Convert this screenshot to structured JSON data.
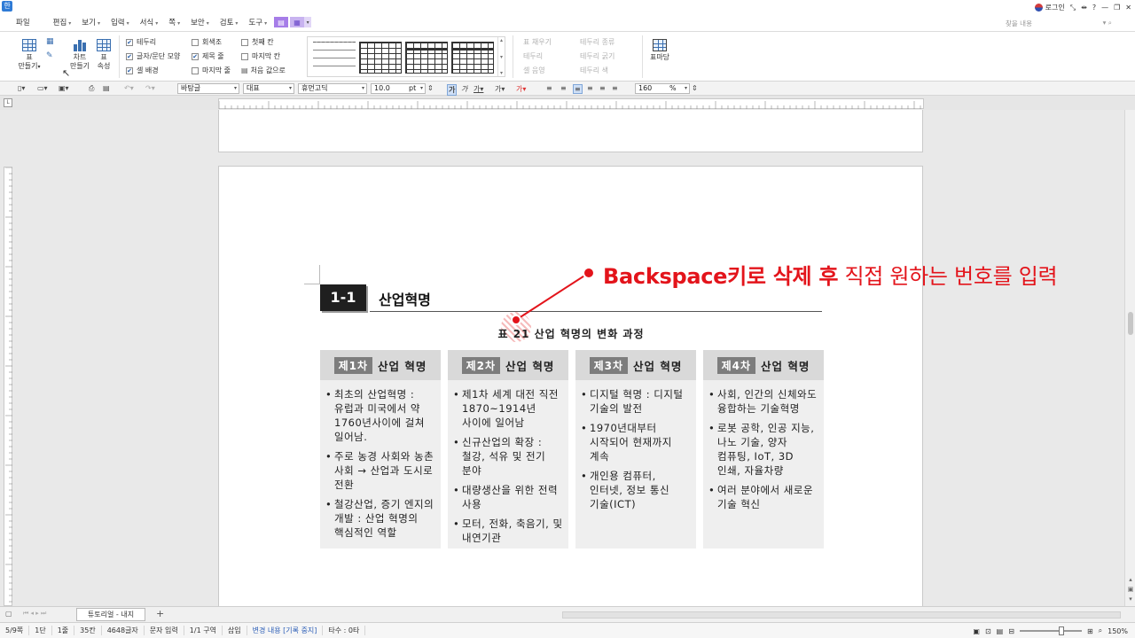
{
  "menubar": {
    "items": [
      "파일",
      "편집",
      "보기",
      "입력",
      "서식",
      "쪽",
      "보안",
      "검토",
      "도구"
    ],
    "login": "로그인",
    "window_controls": [
      "⤡",
      "⇹",
      "?",
      "—",
      "❐",
      "✕"
    ],
    "search_placeholder": "찾을 내용"
  },
  "ribbon": {
    "table_make": "표\n만들기",
    "chart_make": "차트\n만들기",
    "table_prop": "표\n속성",
    "checks": [
      {
        "label": "테두리",
        "checked": true
      },
      {
        "label": "글자/문단 모양",
        "checked": true
      },
      {
        "label": "셀 배경",
        "checked": true
      },
      {
        "label": "회색조",
        "checked": false
      },
      {
        "label": "제목 줄",
        "checked": true
      },
      {
        "label": "마지막 줄",
        "checked": false
      },
      {
        "label": "첫째 칸",
        "checked": false
      },
      {
        "label": "마지막 칸",
        "checked": false
      }
    ],
    "reset_label": "처음 값으로",
    "disabled": [
      "표 채우기",
      "테두리 종류",
      "테두리",
      "테두리 굵기",
      "셀 음영",
      "테두리 색"
    ],
    "table_draw": "표마당"
  },
  "formatbar": {
    "style": "바탕글",
    "lang": "대표",
    "font": "휴먼고딕",
    "size": "10.0",
    "unit": "pt",
    "zoom": "160",
    "zoom_unit": "%"
  },
  "document": {
    "section_number": "1-1",
    "section_title": "산업혁명",
    "table_caption": "표 21 산업 혁명의 변화 과정",
    "columns": [
      {
        "badge": "제1차",
        "title": "산업 혁명",
        "bullets": [
          "최초의 산업혁명 : 유럽과 미국에서 약 1760년사이에 걸쳐 일어남.",
          "주로 농경 사회와 농촌 사회 → 산업과 도시로 전환",
          "철강산업, 증기 엔지의 개발 : 산업 혁명의 핵심적인 역할"
        ]
      },
      {
        "badge": "제2차",
        "title": "산업 혁명",
        "bullets": [
          "제1차 세계 대전 직전 1870~1914년 사이에 일어남",
          "신규산업의 확장 : 철강, 석유 및 전기 분야",
          "대량생산을 위한 전력 사용",
          "모터, 전화, 축음기, 및 내연기관"
        ]
      },
      {
        "badge": "제3차",
        "title": "산업 혁명",
        "bullets": [
          "디지털 혁명 : 디지털 기술의 발전",
          "1970년대부터 시작되어 현재까지 계속",
          "개인용 컴퓨터, 인터넷, 정보 통신 기술(ICT)"
        ]
      },
      {
        "badge": "제4차",
        "title": "산업 혁명",
        "bullets": [
          "사회, 인간의 신체와도 융합하는 기술혁명",
          "로봇 공학, 인공 지능, 나노 기술, 양자 컴퓨팅, IoT, 3D 인쇄, 자율차량",
          "여러 분야에서 새로운 기술 혁신"
        ]
      }
    ]
  },
  "annotation": {
    "bold_part": "Backspace키로 삭제 후",
    "rest": " 직접 원하는 번호를 입력",
    "color": "#e3141b"
  },
  "tabs": {
    "doc_tab": "튜토리얼 - 내지",
    "add": "+"
  },
  "status": {
    "page": "5/9쪽",
    "column": "1단",
    "line": "1줄",
    "char": "35칸",
    "count": "4648글자",
    "mode": "문자 입력",
    "section": "1/1 구역",
    "insert": "삽입",
    "track": "변경 내용 [기록 중지]",
    "typing": "타수 : 0타",
    "zoom": "150%"
  }
}
